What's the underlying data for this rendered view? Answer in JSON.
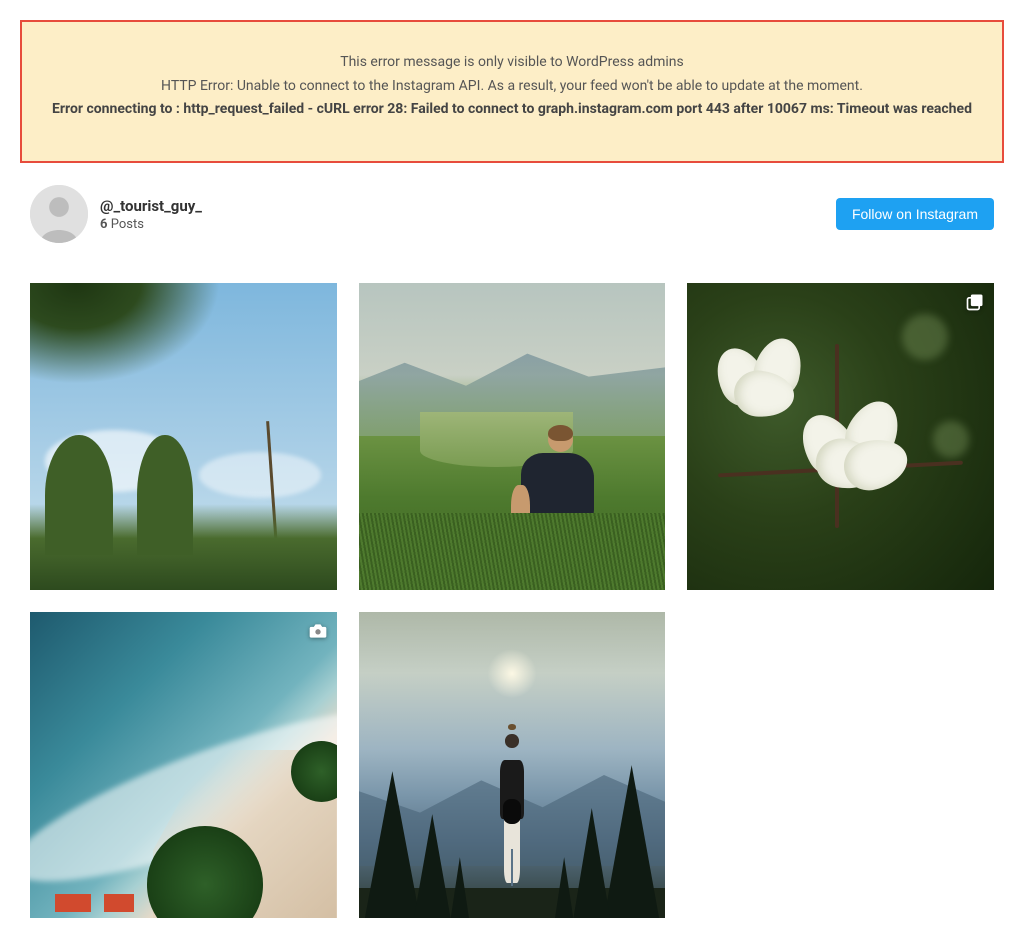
{
  "error": {
    "line1": "This error message is only visible to WordPress admins",
    "line2": "HTTP Error: Unable to connect to the Instagram API. As a result, your feed won't be able to update at the moment.",
    "line3": "Error connecting to : http_request_failed - cURL error 28: Failed to connect to graph.instagram.com port 443 after 10067 ms: Timeout was reached"
  },
  "profile": {
    "username": "@_tourist_guy_",
    "post_count": "6",
    "posts_label": "Posts"
  },
  "actions": {
    "follow_label": "Follow on Instagram"
  },
  "posts": [
    {
      "badge": "none"
    },
    {
      "badge": "none"
    },
    {
      "badge": "carousel"
    },
    {
      "badge": "camera"
    },
    {
      "badge": "none"
    }
  ]
}
